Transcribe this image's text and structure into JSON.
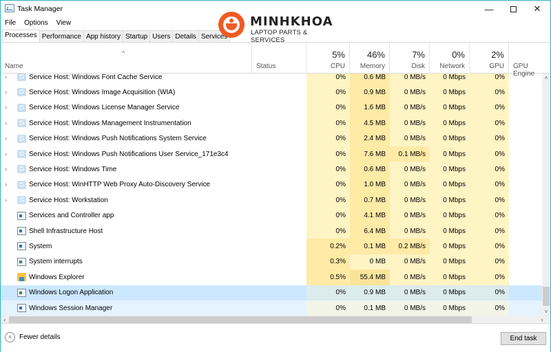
{
  "window": {
    "title": "Task Manager",
    "minimize_glyph": "—",
    "close_glyph": "✕"
  },
  "menu": [
    "File",
    "Options",
    "View"
  ],
  "tabs": [
    {
      "label": "Processes",
      "active": true
    },
    {
      "label": "Performance",
      "active": false
    },
    {
      "label": "App history",
      "active": false
    },
    {
      "label": "Startup",
      "active": false
    },
    {
      "label": "Users",
      "active": false
    },
    {
      "label": "Details",
      "active": false
    },
    {
      "label": "Services",
      "active": false
    }
  ],
  "watermark": {
    "name": "MINHKHOA",
    "tagline": "LAPTOP PARTS & SERVICES",
    "color": "#f05a22"
  },
  "columns": {
    "sort_glyph": "^",
    "name": {
      "label": "Name"
    },
    "status": {
      "label": "Status"
    },
    "cpu": {
      "percent": "5%",
      "label": "CPU"
    },
    "memory": {
      "percent": "46%",
      "label": "Memory"
    },
    "disk": {
      "percent": "7%",
      "label": "Disk"
    },
    "network": {
      "percent": "0%",
      "label": "Network"
    },
    "gpu": {
      "percent": "2%",
      "label": "GPU"
    },
    "gpu_engine": {
      "label": "GPU Engine"
    }
  },
  "heat_colors": {
    "light": "#fff4c4",
    "medium": "#ffeaa6",
    "strong": "#f9e49a",
    "selected_row": "#cce8ff",
    "hover_row": "#e5f3ff"
  },
  "processes": [
    {
      "name": "Service Host: Windows Font Cache Service",
      "icon": "gear-icon",
      "expandable": true,
      "cpu": "0%",
      "memory": "0.6 MB",
      "disk": "0 MB/s",
      "network": "0 Mbps",
      "gpu": "0%"
    },
    {
      "name": "Service Host: Windows Image Acquisition (WIA)",
      "icon": "gear-icon",
      "expandable": true,
      "cpu": "0%",
      "memory": "0.9 MB",
      "disk": "0 MB/s",
      "network": "0 Mbps",
      "gpu": "0%"
    },
    {
      "name": "Service Host: Windows License Manager Service",
      "icon": "gear-icon",
      "expandable": true,
      "cpu": "0%",
      "memory": "1.6 MB",
      "disk": "0 MB/s",
      "network": "0 Mbps",
      "gpu": "0%"
    },
    {
      "name": "Service Host: Windows Management Instrumentation",
      "icon": "gear-icon",
      "expandable": true,
      "cpu": "0%",
      "memory": "4.5 MB",
      "disk": "0 MB/s",
      "network": "0 Mbps",
      "gpu": "0%"
    },
    {
      "name": "Service Host: Windows Push Notifications System Service",
      "icon": "gear-icon",
      "expandable": true,
      "cpu": "0%",
      "memory": "2.4 MB",
      "disk": "0 MB/s",
      "network": "0 Mbps",
      "gpu": "0%"
    },
    {
      "name": "Service Host: Windows Push Notifications User Service_171e3c4",
      "icon": "gear-icon",
      "expandable": true,
      "cpu": "0%",
      "memory": "7.6 MB",
      "disk": "0.1 MB/s",
      "network": "0 Mbps",
      "gpu": "0%"
    },
    {
      "name": "Service Host: Windows Time",
      "icon": "gear-icon",
      "expandable": true,
      "cpu": "0%",
      "memory": "0.6 MB",
      "disk": "0 MB/s",
      "network": "0 Mbps",
      "gpu": "0%"
    },
    {
      "name": "Service Host: WinHTTP Web Proxy Auto-Discovery Service",
      "icon": "gear-icon",
      "expandable": true,
      "cpu": "0%",
      "memory": "1.0 MB",
      "disk": "0 MB/s",
      "network": "0 Mbps",
      "gpu": "0%"
    },
    {
      "name": "Service Host: Workstation",
      "icon": "gear-icon",
      "expandable": true,
      "cpu": "0%",
      "memory": "0.7 MB",
      "disk": "0 MB/s",
      "network": "0 Mbps",
      "gpu": "0%"
    },
    {
      "name": "Services and Controller app",
      "icon": "window-app-icon",
      "expandable": false,
      "cpu": "0%",
      "memory": "4.1 MB",
      "disk": "0 MB/s",
      "network": "0 Mbps",
      "gpu": "0%"
    },
    {
      "name": "Shell Infrastructure Host",
      "icon": "window-app-icon",
      "expandable": false,
      "cpu": "0%",
      "memory": "6.4 MB",
      "disk": "0 MB/s",
      "network": "0 Mbps",
      "gpu": "0%"
    },
    {
      "name": "System",
      "icon": "window-app-icon",
      "expandable": false,
      "cpu": "0.2%",
      "memory": "0.1 MB",
      "disk": "0.2 MB/s",
      "network": "0 Mbps",
      "gpu": "0%"
    },
    {
      "name": "System interrupts",
      "icon": "system-interrupts-icon",
      "expandable": false,
      "cpu": "0.3%",
      "memory": "0 MB",
      "disk": "0 MB/s",
      "network": "0 Mbps",
      "gpu": "0%"
    },
    {
      "name": "Windows Explorer",
      "icon": "folder-icon",
      "expandable": false,
      "cpu": "0.5%",
      "memory": "55.4 MB",
      "disk": "0 MB/s",
      "network": "0 Mbps",
      "gpu": "0%"
    },
    {
      "name": "Windows Logon Application",
      "icon": "system-interrupts-icon",
      "expandable": false,
      "state": "selected",
      "cpu": "0%",
      "memory": "0.9 MB",
      "disk": "0 MB/s",
      "network": "0 Mbps",
      "gpu": "0%"
    },
    {
      "name": "Windows Session Manager",
      "icon": "window-app-icon",
      "expandable": false,
      "state": "hover",
      "cpu": "0%",
      "memory": "0.1 MB",
      "disk": "0 MB/s",
      "network": "0 Mbps",
      "gpu": "0%"
    }
  ],
  "scrollbars": {
    "up_glyph": "˄",
    "down_glyph": "˅",
    "left_glyph": "‹",
    "right_glyph": "›"
  },
  "footer": {
    "fewer_details_label": "Fewer details",
    "fewer_details_glyph": "˄",
    "end_task_label": "End task"
  }
}
